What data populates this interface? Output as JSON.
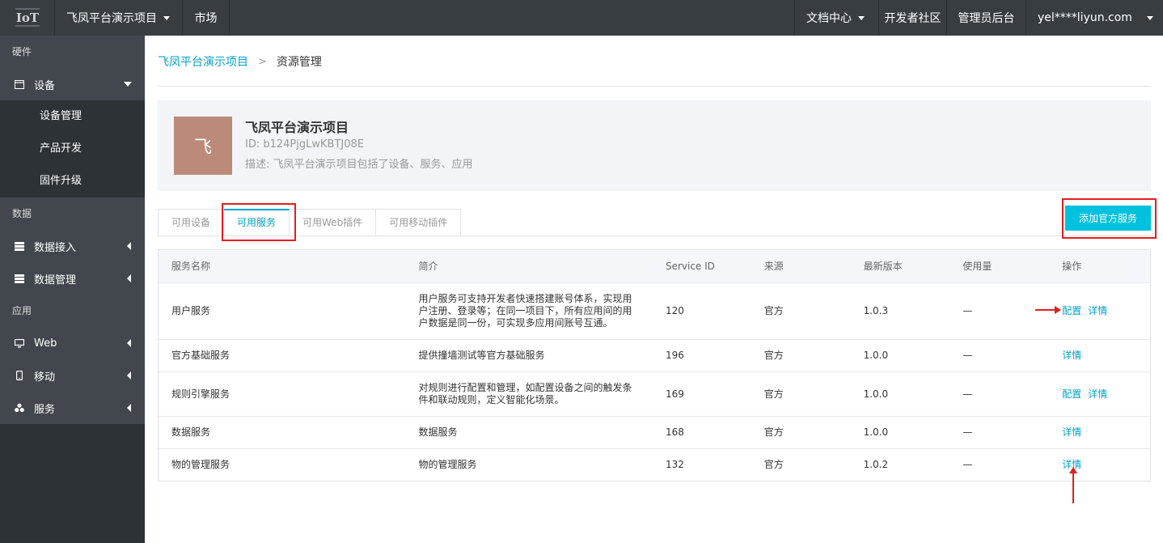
{
  "topbar": {
    "logo_icon": "iot-logo-icon",
    "project_label": "飞凤平台演示项目",
    "market_label": "市场",
    "docs_label": "文档中心",
    "community_label": "开发者社区",
    "admin_label": "管理员后台",
    "user_label": "yel****liyun.com"
  },
  "sidebar": {
    "group_hardware": "硬件",
    "device_label": "设备",
    "device_mgmt": "设备管理",
    "product_dev": "产品开发",
    "firmware": "固件升级",
    "group_data": "数据",
    "data_access": "数据接入",
    "data_mgmt": "数据管理",
    "group_app": "应用",
    "web": "Web",
    "mobile": "移动",
    "service": "服务"
  },
  "breadcrumb": {
    "parent": "飞凤平台演示项目",
    "separator": ">",
    "current": "资源管理"
  },
  "project": {
    "avatar_char": "飞",
    "name": "飞凤平台演示项目",
    "id": "ID: b124PjgLwKBTJ08E",
    "desc": "描述: 飞凤平台演示项目包括了设备、服务、应用"
  },
  "tabs": [
    "可用设备",
    "可用服务",
    "可用Web插件",
    "可用移动插件"
  ],
  "add_button": "添加官方服务",
  "table": {
    "headers": [
      "服务名称",
      "简介",
      "Service ID",
      "来源",
      "最新版本",
      "使用量",
      "操作"
    ],
    "rows": [
      {
        "name": "用户服务",
        "desc": "用户服务可支持开发者快速搭建账号体系，实现用户注册、登录等；在同一项目下，所有应用间的用户数据是同一份，可实现多应用间账号互通。",
        "sid": "120",
        "source": "官方",
        "version": "1.0.3",
        "usage": "—",
        "op1": "配置",
        "op2": "详情"
      },
      {
        "name": "官方基础服务",
        "desc": "提供撞墙测试等官方基础服务",
        "sid": "196",
        "source": "官方",
        "version": "1.0.0",
        "usage": "—",
        "op1": "详情"
      },
      {
        "name": "规则引擎服务",
        "desc": "对规则进行配置和管理，如配置设备之间的触发条件和联动规则，定义智能化场景。",
        "sid": "169",
        "source": "官方",
        "version": "1.0.0",
        "usage": "—",
        "op1": "配置",
        "op2": "详情"
      },
      {
        "name": "数据服务",
        "desc": "数据服务",
        "sid": "168",
        "source": "官方",
        "version": "1.0.0",
        "usage": "—",
        "op1": "详情"
      },
      {
        "name": "物的管理服务",
        "desc": "物的管理服务",
        "sid": "132",
        "source": "官方",
        "version": "1.0.2",
        "usage": "—",
        "op1": "详情"
      }
    ]
  },
  "colors": {
    "accent": "#00a2ca",
    "button": "#00c1de",
    "highlight": "#e21e1e",
    "topbar": "#373d41",
    "sidebar": "#2d3236"
  }
}
